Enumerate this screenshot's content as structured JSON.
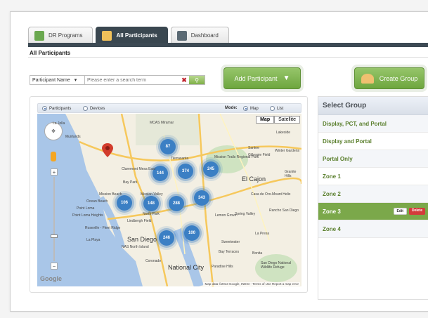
{
  "tabs": [
    {
      "label": "DR Programs",
      "icon": "book-icon",
      "active": false
    },
    {
      "label": "All Participants",
      "icon": "people-icon",
      "active": true
    },
    {
      "label": "Dashboard",
      "icon": "dashboard-icon",
      "active": false
    }
  ],
  "section_title": "All Participants",
  "search": {
    "field": "Participant Name",
    "placeholder": "Please enter a search term"
  },
  "buttons": {
    "add_participant": "Add Participant",
    "create_group": "Create Group"
  },
  "map_header": {
    "participants": "Participants",
    "devices": "Devices",
    "mode_label": "Mode:",
    "map": "Map",
    "list": "List"
  },
  "map": {
    "type_map": "Map",
    "type_satellite": "Satellite",
    "clusters": [
      "87",
      "144",
      "374",
      "245",
      "106",
      "148",
      "288",
      "343",
      "246",
      "100"
    ],
    "labels": [
      "La Jolla",
      "Muirlands",
      "Claremont Mesa East",
      "Bay Park",
      "Mission Valley",
      "North Park",
      "Point Loma",
      "Point Loma Heights",
      "Roseville - Fleet Ridge",
      "La Playa",
      "Coronado",
      "Lemon Grove",
      "Spring Valley",
      "El Cajon",
      "Santee",
      "Winter Gardens",
      "Lakeside",
      "Tierrasanta",
      "Casa de Oro-Mount Helix",
      "Rancho San Diego",
      "La Presa",
      "Bay Terraces",
      "National City",
      "Paradise Hills",
      "Sweetwater",
      "Bonita",
      "San Diego National Wildlife Refuge",
      "MCAS Miramar",
      "Gillespie Field",
      "Mission Trails Regional Park",
      "Granite Hills",
      "NAS North Island",
      "Lindbergh Field",
      "Mission Beach",
      "San Diego",
      "Ocean Beach"
    ],
    "attribution": "Map data ©2013 Google, INEGI - Terms of Use   Report a map error",
    "google": "Google"
  },
  "groups": {
    "title": "Select Group",
    "items": [
      "Display, PCT, and Portal",
      "Display and Portal",
      "Portal Only",
      "Zone 1",
      "Zone 2",
      "Zone 3",
      "Zone 4"
    ],
    "active": "Zone 3",
    "edit": "Edit",
    "delete": "Delete"
  }
}
